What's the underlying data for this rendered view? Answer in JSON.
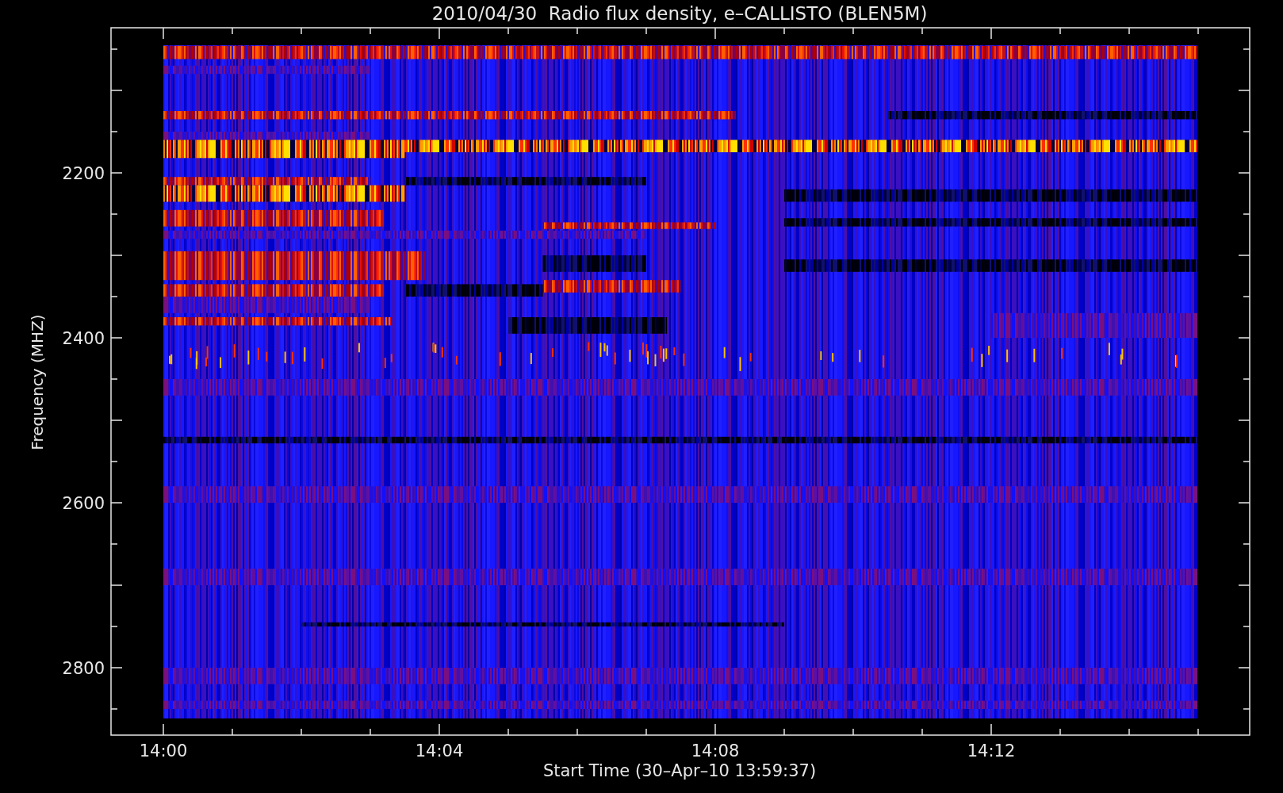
{
  "title": "2010/04/30  Radio flux density, e–CALLISTO (BLEN5M)",
  "y_axis": {
    "label": "Frequency (MHZ)",
    "ticks": [
      "2200",
      "2400",
      "2600",
      "2800"
    ]
  },
  "x_axis": {
    "label": "Start Time (30–Apr–10 13:59:37)",
    "ticks": [
      "14:00",
      "14:04",
      "14:08",
      "14:12"
    ]
  }
}
